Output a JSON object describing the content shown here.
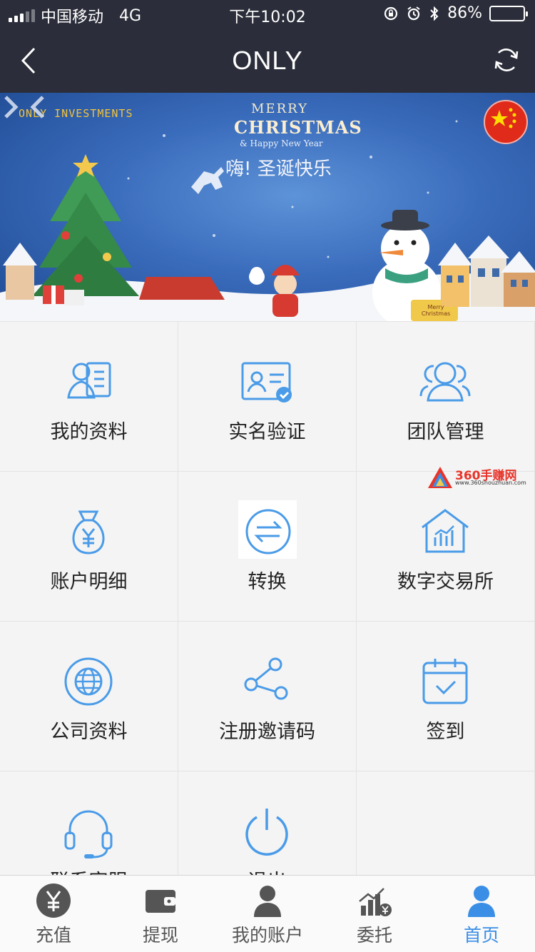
{
  "status_bar": {
    "carrier": "中国移动",
    "network": "4G",
    "time": "下午10:02",
    "battery": "86%",
    "battery_level": 0.86
  },
  "nav": {
    "title": "ONLY"
  },
  "banner": {
    "brand": "ONLY INVESTMENTS",
    "line1": "MERRY",
    "line2": "CHRISTMAS",
    "line3": "& Happy New Year",
    "line4": "嗨! 圣诞快乐",
    "sign": "Merry Christmas"
  },
  "menu": [
    {
      "label": "我的资料",
      "icon": "profile-card-icon"
    },
    {
      "label": "实名验证",
      "icon": "id-verify-icon"
    },
    {
      "label": "团队管理",
      "icon": "team-icon"
    },
    {
      "label": "账户明细",
      "icon": "money-bag-icon"
    },
    {
      "label": "转换",
      "icon": "exchange-icon"
    },
    {
      "label": "数字交易所",
      "icon": "exchange-house-icon"
    },
    {
      "label": "公司资料",
      "icon": "globe-icon"
    },
    {
      "label": "注册邀请码",
      "icon": "share-icon"
    },
    {
      "label": "签到",
      "icon": "calendar-check-icon"
    },
    {
      "label": "联系客服",
      "icon": "headset-icon"
    },
    {
      "label": "退出",
      "icon": "power-icon"
    }
  ],
  "watermark": {
    "title": "360手赚网",
    "url": "www.360shouzhuan.com"
  },
  "tabs": [
    {
      "label": "充值",
      "icon": "yen-coin-icon"
    },
    {
      "label": "提现",
      "icon": "wallet-icon"
    },
    {
      "label": "我的账户",
      "icon": "user-icon"
    },
    {
      "label": "委托",
      "icon": "chart-yen-icon"
    },
    {
      "label": "首页",
      "icon": "home-user-icon",
      "active": true
    }
  ],
  "colors": {
    "topbar": "#2b2e3a",
    "accent": "#3a8ee6",
    "icon": "#4a9be8"
  }
}
